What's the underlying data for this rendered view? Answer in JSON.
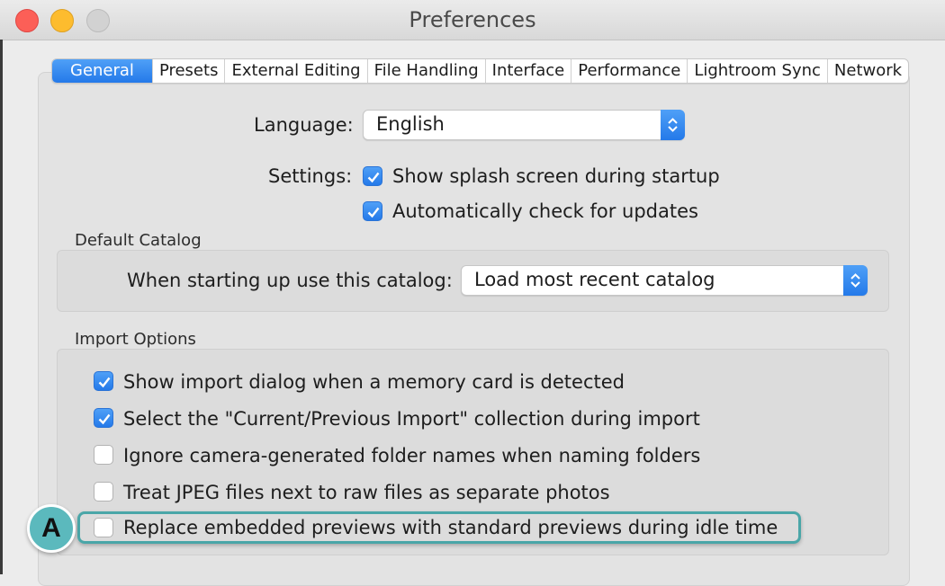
{
  "window": {
    "title": "Preferences"
  },
  "tabs": [
    {
      "label": "General",
      "active": true
    },
    {
      "label": "Presets",
      "active": false
    },
    {
      "label": "External Editing",
      "active": false
    },
    {
      "label": "File Handling",
      "active": false
    },
    {
      "label": "Interface",
      "active": false
    },
    {
      "label": "Performance",
      "active": false
    },
    {
      "label": "Lightroom Sync",
      "active": false
    },
    {
      "label": "Network",
      "active": false
    }
  ],
  "language": {
    "label": "Language:",
    "value": "English"
  },
  "settings": {
    "label": "Settings:",
    "splash": {
      "label": "Show splash screen during startup",
      "checked": true
    },
    "updates": {
      "label": "Automatically check for updates",
      "checked": true
    }
  },
  "default_catalog": {
    "title": "Default Catalog",
    "label": "When starting up use this catalog:",
    "value": "Load most recent catalog"
  },
  "import_options": {
    "title": "Import Options",
    "items": [
      {
        "label": "Show import dialog when a memory card is detected",
        "checked": true
      },
      {
        "label": "Select the \"Current/Previous Import\" collection during import",
        "checked": true
      },
      {
        "label": "Ignore camera-generated folder names when naming folders",
        "checked": false
      },
      {
        "label": "Treat JPEG files next to raw files as separate photos",
        "checked": false
      },
      {
        "label": "Replace embedded previews with standard previews during idle time",
        "checked": false
      }
    ]
  },
  "annotation": {
    "badge": "A"
  },
  "colors": {
    "accent": "#2479e9",
    "highlight": "#4aa6a8",
    "badge": "#5bb9bd"
  }
}
